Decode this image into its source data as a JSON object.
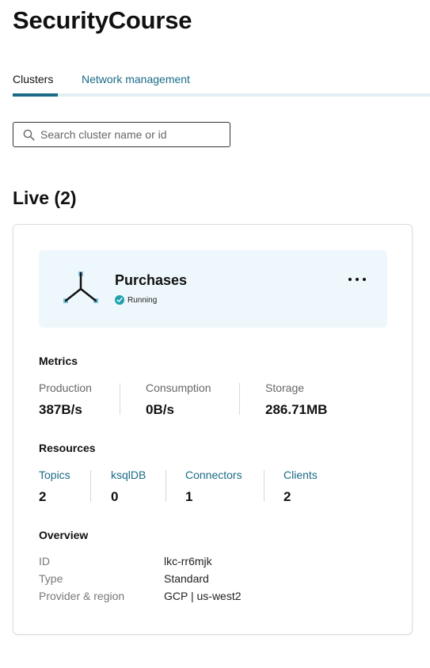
{
  "page": {
    "title": "SecurityCourse"
  },
  "tabs": [
    {
      "label": "Clusters",
      "active": true
    },
    {
      "label": "Network management",
      "active": false
    }
  ],
  "search": {
    "placeholder": "Search cluster name or id",
    "value": ""
  },
  "section": {
    "heading": "Live (2)"
  },
  "cluster": {
    "name": "Purchases",
    "status": "Running",
    "status_color": "#1fa2ad",
    "icon": "cluster-node-icon",
    "more_icon": "more-horizontal-icon",
    "metrics": {
      "title": "Metrics",
      "items": [
        {
          "label": "Production",
          "value": "387B/s"
        },
        {
          "label": "Consumption",
          "value": "0B/s"
        },
        {
          "label": "Storage",
          "value": "286.71MB"
        }
      ]
    },
    "resources": {
      "title": "Resources",
      "items": [
        {
          "label": "Topics",
          "value": "2"
        },
        {
          "label": "ksqlDB",
          "value": "0"
        },
        {
          "label": "Connectors",
          "value": "1"
        },
        {
          "label": "Clients",
          "value": "2"
        }
      ]
    },
    "overview": {
      "title": "Overview",
      "rows": [
        {
          "label": "ID",
          "value": "lkc-rr6mjk"
        },
        {
          "label": "Type",
          "value": "Standard"
        },
        {
          "label": "Provider & region",
          "value": "GCP | us-west2"
        }
      ]
    }
  },
  "colors": {
    "accent": "#1a6b87",
    "hero_bg": "#eef7fb",
    "tab_track": "#e1eef3"
  }
}
